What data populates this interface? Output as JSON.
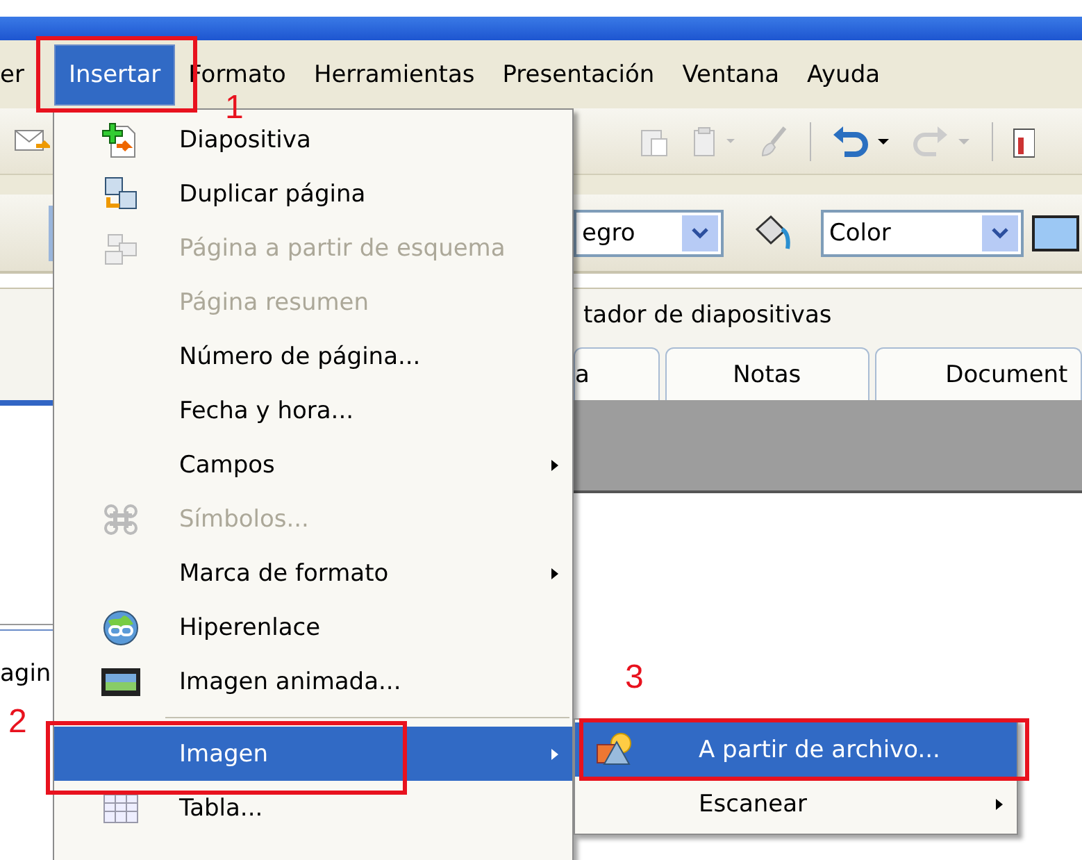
{
  "menu_bar": {
    "items": [
      {
        "label": "er",
        "selected": false
      },
      {
        "label": "Insertar",
        "selected": true
      },
      {
        "label": "Formato",
        "selected": false
      },
      {
        "label": "Herramientas",
        "selected": false
      },
      {
        "label": "Presentación",
        "selected": false
      },
      {
        "label": "Ventana",
        "selected": false
      },
      {
        "label": "Ayuda",
        "selected": false
      }
    ]
  },
  "formatting_toolbar": {
    "font_color_combo": {
      "value": "egro"
    },
    "area_style_combo": {
      "value": "Color"
    }
  },
  "slide_panel": {
    "title": "tador de diapositivas",
    "tabs": [
      {
        "label": "a",
        "selected": false
      },
      {
        "label": "Notas",
        "selected": false
      },
      {
        "label": "Document",
        "selected": false
      }
    ]
  },
  "left_pane": {
    "text": "agin"
  },
  "insert_menu": {
    "items": [
      {
        "kind": "item",
        "label": "Diapositiva",
        "disabled": false,
        "submenu": false,
        "selected": false
      },
      {
        "kind": "item",
        "label": "Duplicar página",
        "disabled": false,
        "submenu": false,
        "selected": false
      },
      {
        "kind": "item",
        "label": "Página a partir de esquema",
        "disabled": true,
        "submenu": false,
        "selected": false
      },
      {
        "kind": "item",
        "label": "Página resumen",
        "disabled": true,
        "submenu": false,
        "selected": false
      },
      {
        "kind": "item",
        "label": "Número de página...",
        "disabled": false,
        "submenu": false,
        "selected": false
      },
      {
        "kind": "item",
        "label": "Fecha y hora...",
        "disabled": false,
        "submenu": false,
        "selected": false
      },
      {
        "kind": "item",
        "label": "Campos",
        "disabled": false,
        "submenu": true,
        "selected": false
      },
      {
        "kind": "item",
        "label": "Símbolos...",
        "disabled": true,
        "submenu": false,
        "selected": false
      },
      {
        "kind": "item",
        "label": "Marca de formato",
        "disabled": false,
        "submenu": true,
        "selected": false
      },
      {
        "kind": "item",
        "label": "Hiperenlace",
        "disabled": false,
        "submenu": false,
        "selected": false
      },
      {
        "kind": "item",
        "label": "Imagen animada...",
        "disabled": false,
        "submenu": false,
        "selected": false
      },
      {
        "kind": "separator"
      },
      {
        "kind": "item",
        "label": "Imagen",
        "disabled": false,
        "submenu": true,
        "selected": true
      },
      {
        "kind": "item",
        "label": "Tabla...",
        "disabled": false,
        "submenu": false,
        "selected": false
      }
    ]
  },
  "image_submenu": {
    "items": [
      {
        "kind": "item",
        "label": "A partir de archivo...",
        "disabled": false,
        "submenu": false,
        "selected": true
      },
      {
        "kind": "item",
        "label": "Escanear",
        "disabled": false,
        "submenu": true,
        "selected": false
      }
    ]
  },
  "annotations": [
    {
      "number": "1"
    },
    {
      "number": "2"
    },
    {
      "number": "3"
    }
  ]
}
